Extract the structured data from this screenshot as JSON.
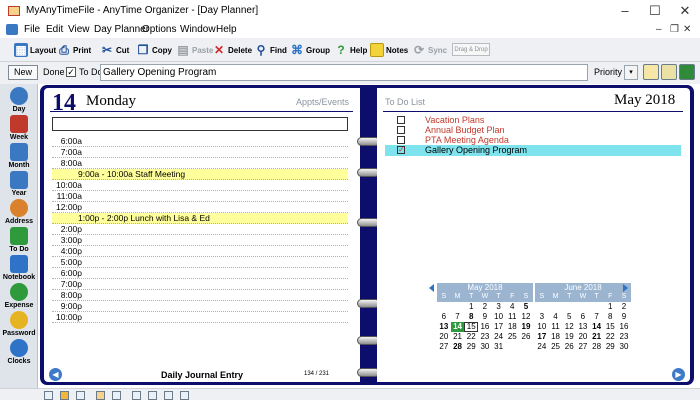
{
  "window": {
    "title": "MyAnyTimeFile - AnyTime Organizer - [Day Planner]"
  },
  "menu": [
    "File",
    "Edit",
    "View",
    "Day Planner",
    "Options",
    "Window",
    "Help"
  ],
  "toolbar": [
    {
      "label": "Layout",
      "icon": "layout-icon",
      "color": "#3b78c2"
    },
    {
      "label": "Print",
      "icon": "print-icon",
      "color": "#5a6b7c"
    },
    {
      "label": "Cut",
      "icon": "scissors-icon",
      "color": "#3b78c2"
    },
    {
      "label": "Copy",
      "icon": "copy-icon",
      "color": "#3b78c2"
    },
    {
      "label": "Paste",
      "icon": "paste-icon",
      "color": "#9aa0a6"
    },
    {
      "label": "Delete",
      "icon": "delete-x-icon",
      "color": "#d12b2b"
    },
    {
      "label": "Find",
      "icon": "magnifier-icon",
      "color": "#1f4e9a"
    },
    {
      "label": "Group",
      "icon": "group-icon",
      "color": "#2e73c7"
    },
    {
      "label": "Help",
      "icon": "help-icon",
      "color": "#2e9a3c"
    },
    {
      "label": "Notes",
      "icon": "notes-icon",
      "color": "#f2d43a"
    },
    {
      "label": "Sync",
      "icon": "sync-icon",
      "color": "#9aa0a6"
    },
    {
      "label": "Drag & Drop",
      "icon": "drag-drop-area",
      "color": "#f7f7f7"
    }
  ],
  "taskbar": {
    "new_label": "New",
    "done_label": "Done",
    "todo_label": "To Do",
    "task_value": "Gallery Opening Program",
    "priority_label": "Priority"
  },
  "sidebar": [
    {
      "label": "Day",
      "icon": "clock-calendar-icon",
      "color": "#3b78c2"
    },
    {
      "label": "Week",
      "icon": "week-calendar-icon",
      "color": "#c0392b"
    },
    {
      "label": "Month",
      "icon": "month-calendar-icon",
      "color": "#3b78c2"
    },
    {
      "label": "Year",
      "icon": "year-calendar-icon",
      "color": "#3b78c2"
    },
    {
      "label": "Address",
      "icon": "people-icon",
      "color": "#d9822b"
    },
    {
      "label": "To Do",
      "icon": "clipboard-icon",
      "color": "#2e9a3c"
    },
    {
      "label": "Notebook",
      "icon": "notebook-icon",
      "color": "#2e73c7"
    },
    {
      "label": "Expense",
      "icon": "money-icon",
      "color": "#2e9a3c"
    },
    {
      "label": "Password",
      "icon": "key-icon",
      "color": "#e6b422"
    },
    {
      "label": "Clocks",
      "icon": "globe-clock-icon",
      "color": "#2e73c7"
    }
  ],
  "day": {
    "number": "14",
    "name": "Monday",
    "appts_label": "Appts/Events",
    "journal_label": "Daily Journal Entry",
    "page_count": "134 / 231",
    "slots": [
      {
        "time": "6:00a",
        "event": ""
      },
      {
        "time": "7:00a",
        "event": ""
      },
      {
        "time": "8:00a",
        "event": ""
      },
      {
        "time": "",
        "event": "9:00a - 10:00a  Staff Meeting",
        "highlight": true
      },
      {
        "time": "10:00a",
        "event": ""
      },
      {
        "time": "11:00a",
        "event": ""
      },
      {
        "time": "12:00p",
        "event": ""
      },
      {
        "time": "",
        "event": "1:00p - 2:00p  Lunch with Lisa & Ed",
        "highlight": true
      },
      {
        "time": "2:00p",
        "event": ""
      },
      {
        "time": "3:00p",
        "event": ""
      },
      {
        "time": "4:00p",
        "event": ""
      },
      {
        "time": "5:00p",
        "event": ""
      },
      {
        "time": "6:00p",
        "event": ""
      },
      {
        "time": "7:00p",
        "event": ""
      },
      {
        "time": "8:00p",
        "event": ""
      },
      {
        "time": "9:00p",
        "event": ""
      },
      {
        "time": "10:00p",
        "event": ""
      }
    ]
  },
  "todo": {
    "title": "To Do List",
    "month_title": "May 2018",
    "items": [
      {
        "text": "Vacation Plans",
        "done": false,
        "color": "#c0392b"
      },
      {
        "text": "Annual Budget Plan",
        "done": false,
        "color": "#c0392b"
      },
      {
        "text": "PTA Meeting Agenda",
        "done": false,
        "color": "#c0392b"
      },
      {
        "text": "Gallery Opening Program",
        "done": true,
        "color": "#000000",
        "selected": true
      }
    ]
  },
  "calendars": [
    {
      "title": "May 2018",
      "dow": [
        "S",
        "M",
        "T",
        "W",
        "T",
        "F",
        "S"
      ],
      "weeks": [
        [
          "",
          "",
          "1",
          "2",
          "3",
          "4",
          "5"
        ],
        [
          "6",
          "7",
          "8",
          "9",
          "10",
          "11",
          "12"
        ],
        [
          "13",
          "14",
          "15",
          "16",
          "17",
          "18",
          "19"
        ],
        [
          "20",
          "21",
          "22",
          "23",
          "24",
          "25",
          "26"
        ],
        [
          "27",
          "28",
          "29",
          "30",
          "31",
          "",
          ""
        ]
      ],
      "bold": [
        "5",
        "8",
        "13",
        "19",
        "28"
      ],
      "today": "14",
      "boxed": "15"
    },
    {
      "title": "June 2018",
      "dow": [
        "S",
        "M",
        "T",
        "W",
        "T",
        "F",
        "S"
      ],
      "weeks": [
        [
          "",
          "",
          "",
          "",
          "",
          "1",
          "2"
        ],
        [
          "3",
          "4",
          "5",
          "6",
          "7",
          "8",
          "9"
        ],
        [
          "10",
          "11",
          "12",
          "13",
          "14",
          "15",
          "16"
        ],
        [
          "17",
          "18",
          "19",
          "20",
          "21",
          "22",
          "23"
        ],
        [
          "24",
          "25",
          "26",
          "27",
          "28",
          "29",
          "30"
        ]
      ],
      "bold": [
        "14",
        "17",
        "21"
      ],
      "today": "",
      "boxed": ""
    }
  ],
  "colors": {
    "book": "#0d0d6b",
    "highlight": "#ffff9c",
    "selected_row": "#7fe3ee",
    "cal_header": "#9bb5d1"
  }
}
